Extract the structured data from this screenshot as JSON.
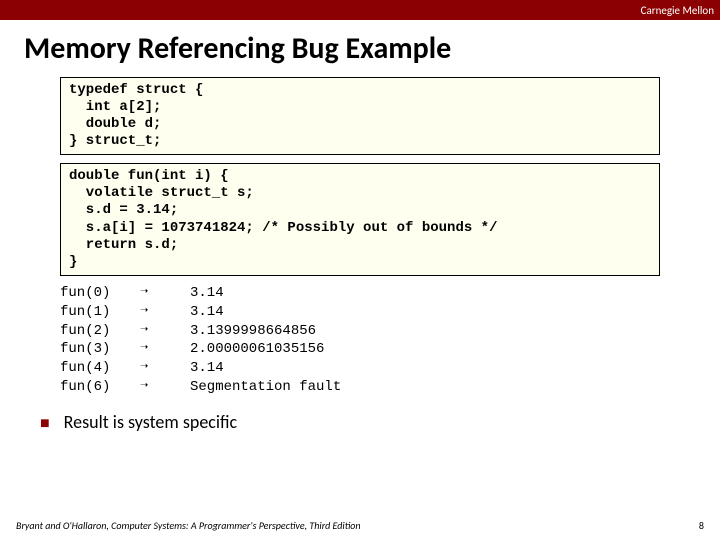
{
  "header": {
    "org": "Carnegie Mellon"
  },
  "title": "Memory Referencing Bug Example",
  "code1": "typedef struct {\n  int a[2];\n  double d;\n} struct_t;",
  "code2": "double fun(int i) {\n  volatile struct_t s;\n  s.d = 3.14;\n  s.a[i] = 1073741824; /* Possibly out of bounds */\n  return s.d;\n}",
  "results": [
    {
      "call": "fun(0)",
      "arrow": "➝",
      "out": "3.14"
    },
    {
      "call": "fun(1)",
      "arrow": "➝",
      "out": "3.14"
    },
    {
      "call": "fun(2)",
      "arrow": "➝",
      "out": "3.1399998664856"
    },
    {
      "call": "fun(3)",
      "arrow": "➝",
      "out": "2.00000061035156"
    },
    {
      "call": "fun(4)",
      "arrow": "➝",
      "out": "3.14"
    },
    {
      "call": "fun(6)",
      "arrow": "➝",
      "out": "Segmentation fault"
    }
  ],
  "bullet": "Result is system specific",
  "footer": {
    "book": "Bryant and O'Hallaron, Computer Systems: A Programmer's Perspective, Third Edition",
    "page": "8"
  }
}
